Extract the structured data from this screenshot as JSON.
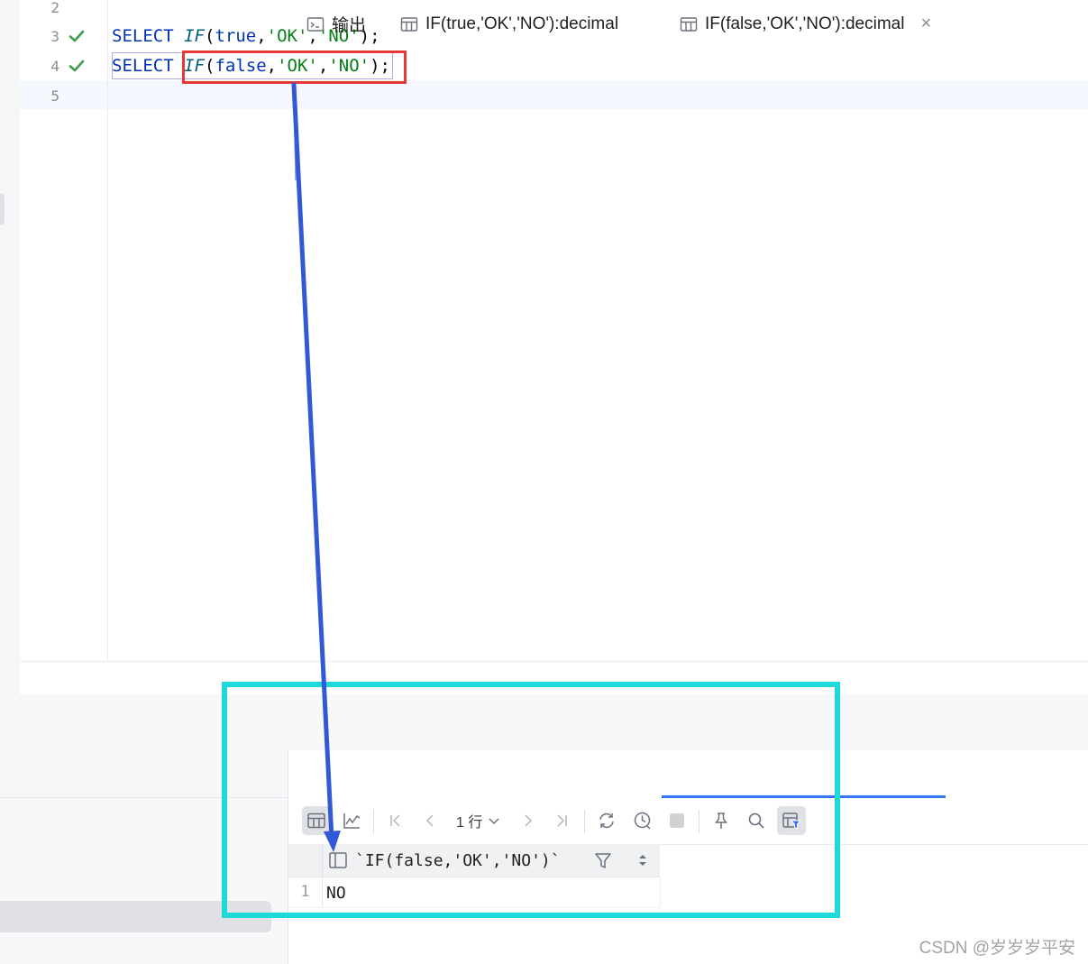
{
  "editor": {
    "lines": [
      {
        "number": "2",
        "status": ""
      },
      {
        "number": "3",
        "status": "ok"
      },
      {
        "number": "4",
        "status": "ok"
      },
      {
        "number": "5",
        "status": ""
      }
    ],
    "code_line_3": {
      "kw": "SELECT",
      "fn": "IF",
      "open": "(",
      "bool": "true",
      "c1": ",",
      "s1": "'OK'",
      "c2": ",",
      "s2": "'NO'",
      "close": ");"
    },
    "code_line_4": {
      "kw": "SELECT",
      "fn": "IF",
      "open": "(",
      "bool": "false",
      "c1": ",",
      "s1": "'OK'",
      "c2": ",",
      "s2": "'NO'",
      "close": ")",
      "semi": ";"
    }
  },
  "results": {
    "tabs": [
      {
        "label": "输出",
        "icon": "console-icon"
      },
      {
        "label": "IF(true,'OK','NO'):decimal",
        "icon": "table-icon"
      },
      {
        "label": "IF(false,'OK','NO'):decimal",
        "icon": "table-icon",
        "active": true,
        "close": "×"
      }
    ],
    "rows_selector": "1 行",
    "column_header": "`IF(false,'OK','NO')`",
    "rows": [
      {
        "num": "1",
        "value": "NO"
      }
    ]
  },
  "colors": {
    "highlight_red": "#e53935",
    "highlight_cyan": "#1fd8d8",
    "arrow_blue": "#3358d6",
    "accent": "#3574f0"
  },
  "watermark": "CSDN @岁岁岁平安"
}
